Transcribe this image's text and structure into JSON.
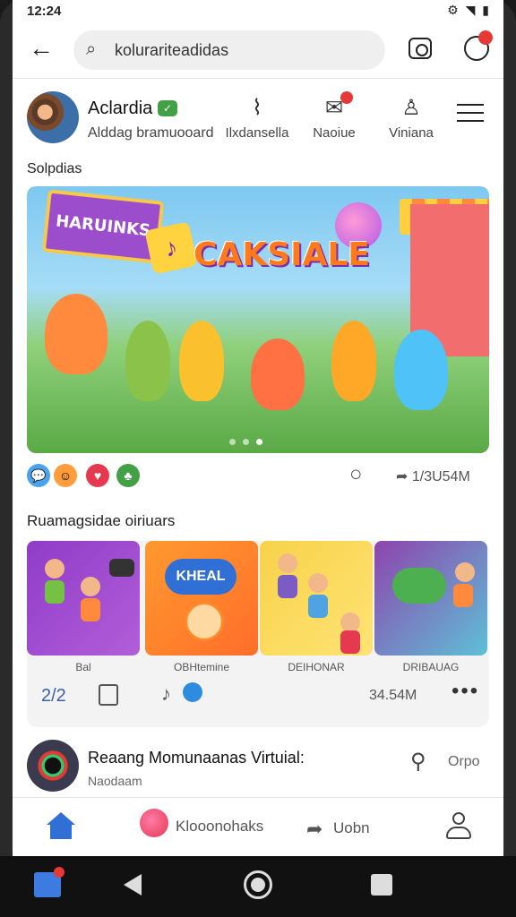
{
  "status": {
    "time": "12:24",
    "right_icons": "⚙ ◥ ▮"
  },
  "search": {
    "query": "kolurariteadidas"
  },
  "profile": {
    "name": "Aclardia",
    "badge": "✓",
    "subtitle": "Alddag bramuooard",
    "actions": [
      {
        "icon": "music-note-icon",
        "glyph": "⌇",
        "label": "Ilxdansella"
      },
      {
        "icon": "message-icon",
        "glyph": "✉",
        "label": "Naoiue"
      },
      {
        "icon": "person-icon",
        "glyph": "♙",
        "label": "Viniana"
      }
    ]
  },
  "section1": {
    "title": "Solpdias"
  },
  "banner": {
    "sign": "HARUINKS",
    "title": "CAKSIALE"
  },
  "reactions": {
    "share_count": "1/3U54M"
  },
  "section2": {
    "title": "Ruamagsidae oiriuars"
  },
  "cards": [
    {
      "label": "Bal"
    },
    {
      "label": "OBHtemine",
      "bubble": "KHEAL"
    },
    {
      "label": "DEIHONAR"
    },
    {
      "label": "DRIBAUAG"
    }
  ],
  "card_stats": {
    "number": "2/2",
    "count": "34.54M",
    "more": "•••"
  },
  "virtual": {
    "title": "Reaang Momunaanas Virtuial:",
    "subtitle": "Naodaam",
    "option": "Orpo"
  },
  "tabbar": {
    "mid_label": "Klooonohaks",
    "open_label": "Uobn"
  },
  "colors": {
    "accent": "#2f6fd6",
    "badge_red": "#e53935",
    "brand_green": "#43a047"
  }
}
